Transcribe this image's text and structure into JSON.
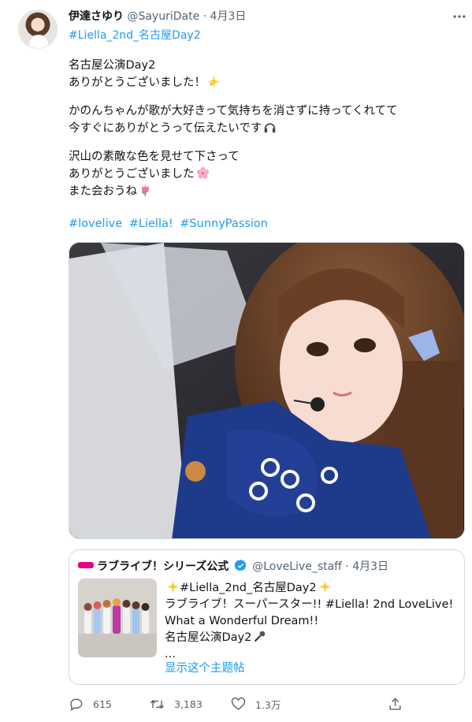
{
  "tweet": {
    "author_name": "伊達さゆり",
    "author_handle": "@SayuriDate",
    "separator": "·",
    "date": "4月3日",
    "top_hashtag": "#Liella_2nd_名古屋Day2",
    "lines": [
      "名古屋公演Day2",
      "ありがとうございました！",
      "かのんちゃんが歌が大好きって気持ちを消さずに持ってくれてて",
      "今すぐにありがとうって伝えたいです",
      "沢山の素敵な色を見せて下さって",
      "ありがとうございました",
      "また会おうね"
    ],
    "hashtags": [
      "#lovelive",
      "#Liella!",
      "#SunnyPassion"
    ]
  },
  "quote": {
    "name": "ラブライブ！シリーズ公式",
    "handle": "@LoveLive_staff",
    "separator": "·",
    "date": "4月3日",
    "lines": [
      "#Liella_2nd_名古屋Day2",
      "ラブライブ！スーパースター!! #Liella! 2nd LoveLive!",
      "What a Wonderful Dream!!",
      "名古屋公演Day2",
      "..."
    ],
    "show_thread": "显示这个主题帖"
  },
  "actions": {
    "replies": "615",
    "retweets": "3,183",
    "likes": "1.3万"
  },
  "icons": {
    "more": "more-icon",
    "reply": "reply-icon",
    "retweet": "retweet-icon",
    "like": "heart-icon",
    "share": "share-icon",
    "verified": "verified-badge-icon"
  },
  "colors": {
    "link": "#1d9bf0",
    "text": "#0f1419",
    "secondary": "#536471",
    "border": "#cfd9de",
    "brand": "#e4007f"
  }
}
